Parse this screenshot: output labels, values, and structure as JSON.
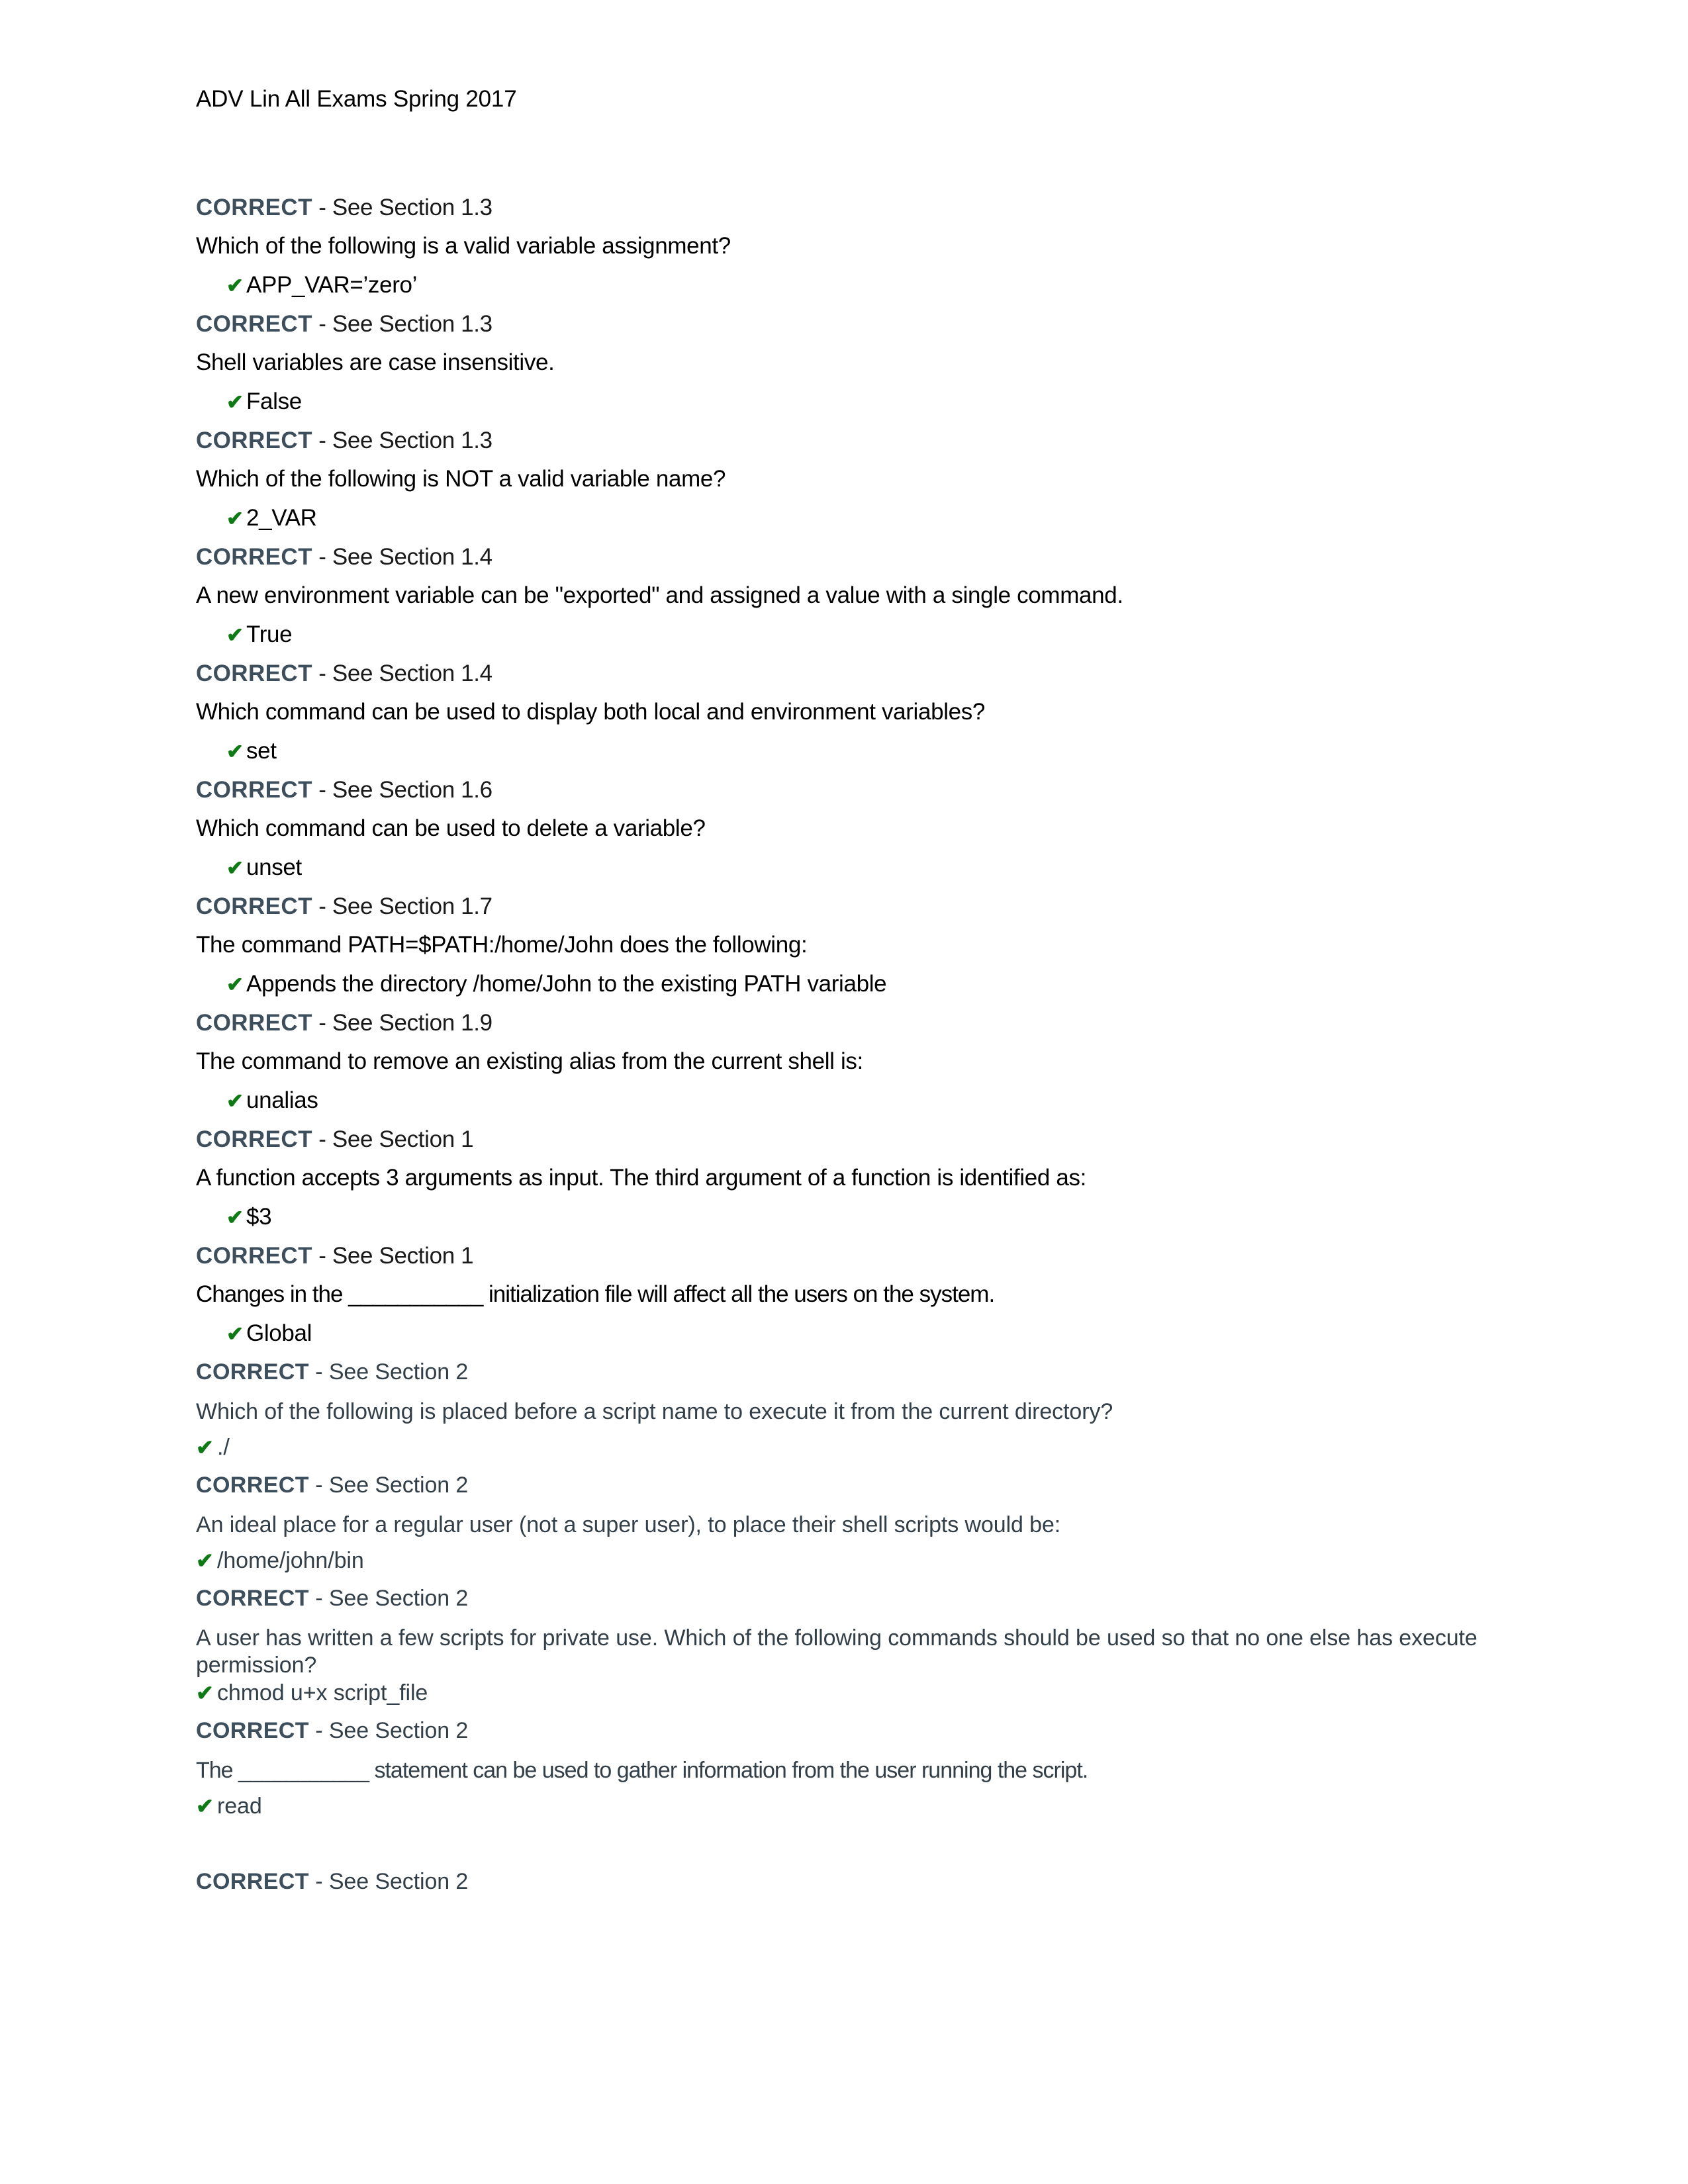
{
  "document": {
    "header": "ADV Lin All Exams Spring 2017",
    "correct_label": "CORRECT",
    "check_icon": "✔",
    "colors": {
      "correct_label": "#3d4f5c",
      "check_mark": "#0f7a15",
      "upper_text": "#000000",
      "lower_text": "#333f48",
      "page_background": "#ffffff"
    }
  },
  "items": [
    {
      "reference": " - See Section 1.3",
      "question": "Which of the following is a valid variable assignment?",
      "answer": "APP_VAR=’zero’"
    },
    {
      "reference": " - See Section 1.3",
      "question": "Shell variables are case insensitive.",
      "answer": "False"
    },
    {
      "reference": " - See Section 1.3",
      "question": "Which of the following is NOT a valid variable name?",
      "answer": "2_VAR"
    },
    {
      "reference": " - See Section 1.4",
      "question": "A new environment variable can be \"exported\" and assigned a value with a single command.",
      "answer": "True"
    },
    {
      "reference": " - See Section 1.4",
      "question": "Which command can be used to display both local and environment variables?",
      "answer": "set"
    },
    {
      "reference": " - See Section 1.6",
      "question": "Which command can be used to delete a variable?",
      "answer": "unset"
    },
    {
      "reference": " - See Section 1.7",
      "question": "The command PATH=$PATH:/home/John does the following:",
      "answer": "Appends the directory /home/John to the existing PATH variable"
    },
    {
      "reference": " - See Section 1.9",
      "question": "The command to remove an existing alias from the current shell is:",
      "answer": "unalias"
    },
    {
      "reference": " - See Section 1",
      "question": "A function accepts 3 arguments as input. The third argument of a function is identified as:",
      "answer": "$3"
    },
    {
      "reference": " - See Section 1",
      "question": "Changes in the ___________ initialization file will affect all the users on the system.",
      "answer": "Global"
    },
    {
      "reference": " - See Section 2",
      "question": "Which of the following is placed before a script name to execute it from the current directory?",
      "answer": "./"
    },
    {
      "reference": " - See Section 2",
      "question": "An ideal place for a regular user (not a super user), to place their shell scripts would be:",
      "answer": "/home/john/bin"
    },
    {
      "reference": " - See Section 2",
      "question": "A user has written a few scripts for private use. Which of the following commands should be used so that no one else has execute permission?",
      "answer": "chmod u+x script_file"
    },
    {
      "reference": " - See Section 2",
      "question": "The ___________ statement can be used to gather information from the user running the script.",
      "answer": "read"
    },
    {
      "reference": " - See Section 2",
      "question": "",
      "answer": ""
    }
  ]
}
